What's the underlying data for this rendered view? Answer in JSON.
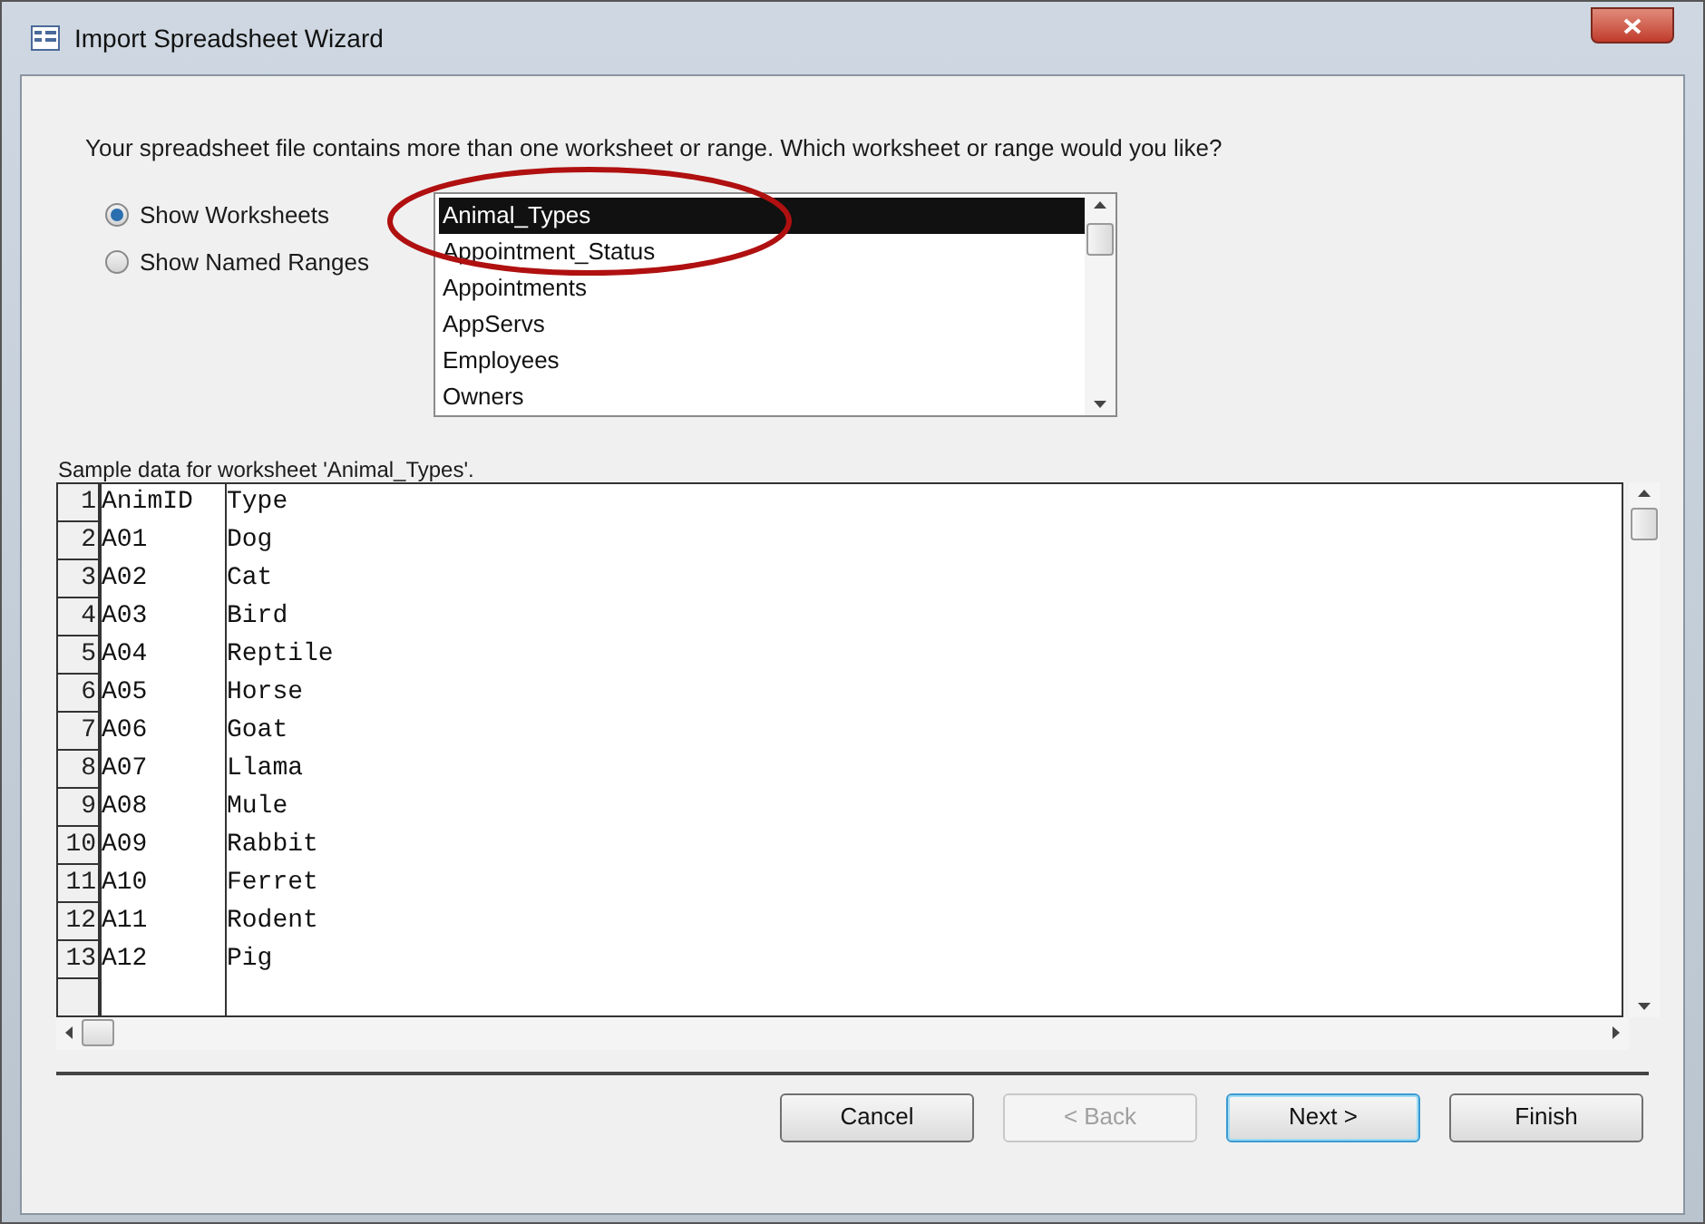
{
  "window": {
    "title": "Import Spreadsheet Wizard"
  },
  "prompt": "Your spreadsheet file contains more than one worksheet or range. Which worksheet or range would you like?",
  "view_options": [
    {
      "label": "Show Worksheets",
      "selected": true
    },
    {
      "label": "Show Named Ranges",
      "selected": false
    }
  ],
  "sheet_list": {
    "items": [
      {
        "label": "Animal_Types",
        "selected": true
      },
      {
        "label": "Appointment_Status",
        "selected": false
      },
      {
        "label": "Appointments",
        "selected": false
      },
      {
        "label": "AppServs",
        "selected": false
      },
      {
        "label": "Employees",
        "selected": false
      },
      {
        "label": "Owners",
        "selected": false
      }
    ],
    "highlight_annotation": true
  },
  "sample": {
    "caption": "Sample data for worksheet 'Animal_Types'.",
    "rows": [
      {
        "number": "1",
        "cells": [
          "AnimID",
          "Type"
        ]
      },
      {
        "number": "2",
        "cells": [
          "A01",
          "Dog"
        ]
      },
      {
        "number": "3",
        "cells": [
          "A02",
          "Cat"
        ]
      },
      {
        "number": "4",
        "cells": [
          "A03",
          "Bird"
        ]
      },
      {
        "number": "5",
        "cells": [
          "A04",
          "Reptile"
        ]
      },
      {
        "number": "6",
        "cells": [
          "A05",
          "Horse"
        ]
      },
      {
        "number": "7",
        "cells": [
          "A06",
          "Goat"
        ]
      },
      {
        "number": "8",
        "cells": [
          "A07",
          "Llama"
        ]
      },
      {
        "number": "9",
        "cells": [
          "A08",
          "Mule"
        ]
      },
      {
        "number": "10",
        "cells": [
          "A09",
          "Rabbit"
        ]
      },
      {
        "number": "11",
        "cells": [
          "A10",
          "Ferret"
        ]
      },
      {
        "number": "12",
        "cells": [
          "A11",
          "Rodent"
        ]
      },
      {
        "number": "13",
        "cells": [
          "A12",
          "Pig"
        ]
      }
    ]
  },
  "buttons": [
    {
      "label": "Cancel",
      "disabled": false,
      "default": false
    },
    {
      "label": "< Back",
      "disabled": true,
      "default": false
    },
    {
      "label": "Next >",
      "disabled": false,
      "default": true
    },
    {
      "label": "Finish",
      "disabled": false,
      "default": false
    }
  ]
}
